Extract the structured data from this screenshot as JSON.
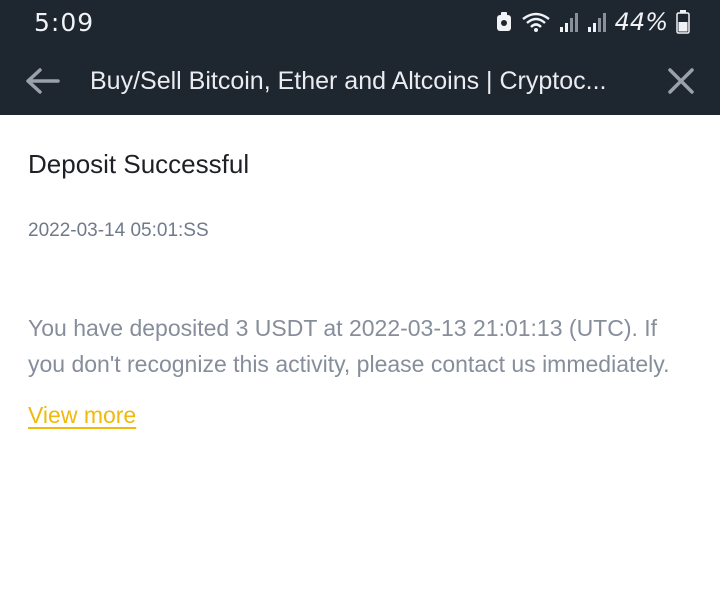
{
  "status_bar": {
    "time": "5:09",
    "battery_percent": "44%",
    "icons": [
      "alert-icon",
      "wifi-icon",
      "signal-icon",
      "signal-icon-2",
      "battery-icon"
    ]
  },
  "app_bar": {
    "title": "Buy/Sell Bitcoin, Ether and Altcoins | Cryptoc...",
    "back_icon": "arrow-left-icon",
    "close_icon": "close-icon"
  },
  "notification": {
    "title": "Deposit Successful",
    "timestamp": "2022-03-14 05:01:SS",
    "message": "You have deposited 3 USDT at 2022-03-13 21:01:13 (UTC). If you don't recognize this activity, please contact us immediately.",
    "link_label": "View more"
  },
  "colors": {
    "topbar_bg": "#1e2630",
    "accent": "#f0b90b",
    "text_primary": "#1e2026",
    "text_secondary": "#868e9b"
  }
}
